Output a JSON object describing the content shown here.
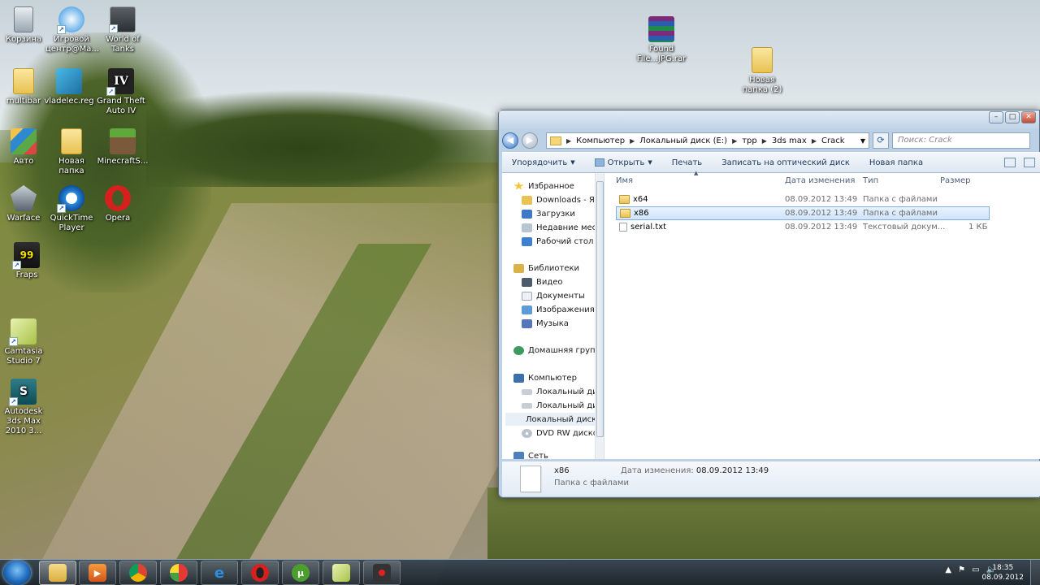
{
  "desktop": {
    "icons": [
      {
        "label": "Корзина",
        "icon": "recycle-bin-icon"
      },
      {
        "label": "Игровой центр@Ма...",
        "icon": "game-center-icon"
      },
      {
        "label": "World of Tanks",
        "icon": "world-of-tanks-icon"
      },
      {
        "label": "multibar",
        "icon": "folder-icon"
      },
      {
        "label": "vladelec.reg",
        "icon": "registry-file-icon"
      },
      {
        "label": "Grand Theft Auto IV",
        "icon": "gta-iv-icon"
      },
      {
        "label": "Авто",
        "icon": "auto-icon"
      },
      {
        "label": "Новая папка",
        "icon": "folder-icon"
      },
      {
        "label": "MinecraftS...",
        "icon": "minecraft-icon"
      },
      {
        "label": "Warface",
        "icon": "warface-icon"
      },
      {
        "label": "QuickTime Player",
        "icon": "quicktime-icon"
      },
      {
        "label": "Opera",
        "icon": "opera-icon"
      },
      {
        "label": "Fraps",
        "icon": "fraps-icon"
      },
      {
        "label": "Camtasia Studio 7",
        "icon": "camtasia-icon"
      },
      {
        "label": "Autodesk 3ds Max 2010 3...",
        "icon": "3ds-max-icon"
      },
      {
        "label": "Found File...JPG.rar",
        "icon": "winrar-archive-icon"
      },
      {
        "label": "Новая папка (2)",
        "icon": "folder-icon"
      }
    ]
  },
  "explorer": {
    "address": {
      "crumbs": [
        "Компьютер",
        "Локальный диск (E:)",
        "трр",
        "3ds max",
        "Crack"
      ]
    },
    "search_placeholder": "Поиск: Crack",
    "toolbar": {
      "organize": "Упорядочить",
      "open": "Открыть",
      "print": "Печать",
      "burn": "Записать на оптический диск",
      "new_folder": "Новая папка"
    },
    "nav": {
      "favorites": "Избранное",
      "downloads_ya": "Downloads - Ярл",
      "downloads": "Загрузки",
      "recent": "Недавние места",
      "desktop": "Рабочий стол",
      "libraries": "Библиотеки",
      "video": "Видео",
      "documents": "Документы",
      "pictures": "Изображения",
      "music": "Музыка",
      "homegroup": "Домашняя группа",
      "computer": "Компьютер",
      "disk1": "Локальный диск",
      "disk2": "Локальный диск",
      "disk3": "Локальный диск",
      "dvd": "DVD RW дисково",
      "network": "Сеть"
    },
    "columns": {
      "name": "Имя",
      "modified": "Дата изменения",
      "type": "Тип",
      "size": "Размер"
    },
    "files": [
      {
        "name": "x64",
        "modified": "08.09.2012 13:49",
        "type": "Папка с файлами",
        "size": ""
      },
      {
        "name": "x86",
        "modified": "08.09.2012 13:49",
        "type": "Папка с файлами",
        "size": ""
      },
      {
        "name": "serial.txt",
        "modified": "08.09.2012 13:49",
        "type": "Текстовый докум...",
        "size": "1 КБ"
      }
    ],
    "details": {
      "name": "x86",
      "type": "Папка с файлами",
      "modified_label": "Дата изменения:",
      "modified_value": "08.09.2012 13:49"
    }
  },
  "taskbar": {
    "apps": [
      "explorer-icon",
      "media-player-icon",
      "chrome-icon",
      "app-icon",
      "internet-explorer-icon",
      "opera-icon",
      "utorrent-icon",
      "camtasia-icon",
      "recorder-icon"
    ],
    "tray_up": "▲",
    "time": "18:35",
    "date": "08.09.2012"
  }
}
